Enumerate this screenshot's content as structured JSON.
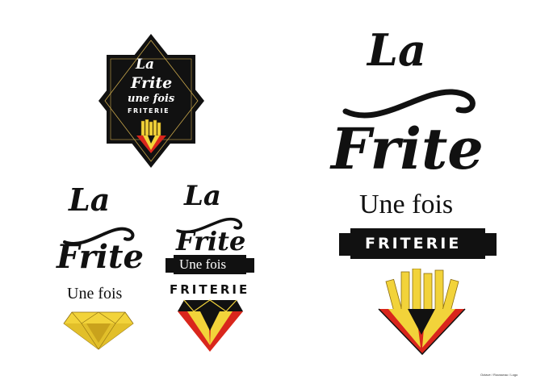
{
  "logos": {
    "badge": {
      "line1": "La",
      "line2": "Frite",
      "line3": "une fois",
      "line4": "FRITERIE"
    },
    "small_yellow": {
      "line1": "La",
      "line2": "Frite",
      "line3": "Une fois"
    },
    "small_color": {
      "line1": "La",
      "line2": "Frite",
      "line3": "Une fois",
      "line4": "FRITERIE"
    },
    "large": {
      "line1": "La",
      "line2": "Frite",
      "line3": "Une fois",
      "line4": "FRITERIE"
    }
  },
  "footer": {
    "caption": "Octave / Rousseau / Logo"
  },
  "colors": {
    "black": "#111111",
    "yellow": "#f2d33a",
    "dark_yellow": "#c9a21c",
    "red": "#d9261c",
    "gold_line": "#c8a64a"
  },
  "icons": [
    "diamond-fries-icon",
    "yellow-diamond-icon",
    "ribbon-banner-icon"
  ]
}
